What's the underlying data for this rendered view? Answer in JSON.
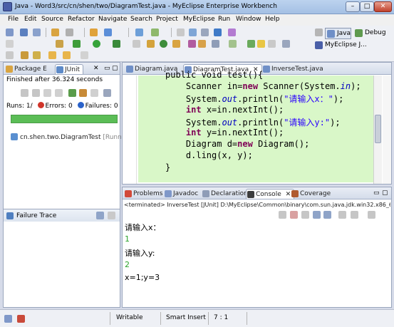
{
  "window": {
    "title": "Java - Word3/src/cn/shen/two/DiagramTest.java - MyEclipse Enterprise Workbench"
  },
  "menu": [
    "File",
    "Edit",
    "Source",
    "Refactor",
    "Navigate",
    "Search",
    "Project",
    "MyEclipse",
    "Run",
    "Window",
    "Help"
  ],
  "perspectives": {
    "java": "Java",
    "debug": "Debug",
    "myeclipse": "MyEclipse J..."
  },
  "left": {
    "tabs": {
      "package": "Package E",
      "junit": "JUnit"
    },
    "status": "Finished after 36.324 seconds",
    "runs_label": "Runs:",
    "runs_value": "1/",
    "errors_label": "Errors:",
    "errors_value": "0",
    "failures_label": "Failures:",
    "failures_value": "0",
    "test": {
      "name": "cn.shen.two.DiagramTest",
      "runner": "[Runne"
    },
    "failure_trace": "Failure Trace"
  },
  "editor": {
    "tabs": [
      "Diagram.java",
      "DiagramTest.java",
      "InverseTest.java"
    ],
    "lines": [
      {
        "parts": [
          {
            "t": "public void test(){",
            "c": "plain"
          }
        ]
      },
      {
        "parts": [
          {
            "t": "    Scanner in=",
            "c": "plain"
          },
          {
            "t": "new",
            "c": "kw"
          },
          {
            "t": " Scanner(System.",
            "c": "plain"
          },
          {
            "t": "in",
            "c": "it"
          },
          {
            "t": ");",
            "c": "plain"
          }
        ]
      },
      {
        "parts": [
          {
            "t": "    System.",
            "c": "plain"
          },
          {
            "t": "out",
            "c": "it"
          },
          {
            "t": ".println(",
            "c": "plain"
          },
          {
            "t": "\"请输入x：\"",
            "c": "str"
          },
          {
            "t": ");",
            "c": "plain"
          }
        ]
      },
      {
        "parts": [
          {
            "t": "    ",
            "c": "plain"
          },
          {
            "t": "int",
            "c": "kw"
          },
          {
            "t": " x=in.nextInt();",
            "c": "plain"
          }
        ]
      },
      {
        "parts": [
          {
            "t": "    System.",
            "c": "plain"
          },
          {
            "t": "out",
            "c": "it"
          },
          {
            "t": ".println(",
            "c": "plain"
          },
          {
            "t": "\"请输入y:\"",
            "c": "str"
          },
          {
            "t": ");",
            "c": "plain"
          }
        ]
      },
      {
        "parts": [
          {
            "t": "    ",
            "c": "plain"
          },
          {
            "t": "int",
            "c": "kw"
          },
          {
            "t": " y=in.nextInt();",
            "c": "plain"
          }
        ]
      },
      {
        "parts": [
          {
            "t": "    Diagram d=",
            "c": "plain"
          },
          {
            "t": "new",
            "c": "kw"
          },
          {
            "t": " Diagram();",
            "c": "plain"
          }
        ]
      },
      {
        "parts": [
          {
            "t": "    d.ling(x, y);",
            "c": "plain"
          }
        ]
      },
      {
        "parts": [
          {
            "t": "}",
            "c": "plain"
          }
        ]
      }
    ]
  },
  "console": {
    "tabs": [
      "Problems",
      "Javadoc",
      "Declaration",
      "Console",
      "Coverage"
    ],
    "terminated": "<terminated> InverseTest [JUnit] D:\\MyEclipse\\Common\\binary\\com.sun.java.jdk.win32.x86_6",
    "output": [
      {
        "text": "请输入x：",
        "kind": "out"
      },
      {
        "text": "1",
        "kind": "in"
      },
      {
        "text": "请输入y:",
        "kind": "out"
      },
      {
        "text": "2",
        "kind": "in"
      },
      {
        "text": "x=1;y=3",
        "kind": "out"
      }
    ]
  },
  "status": {
    "writable": "Writable",
    "insert": "Smart Insert",
    "position": "7 : 1"
  },
  "colors": {
    "progress": "#5bbd56",
    "highlight": "#d9f7c8",
    "keyword": "#7f0055",
    "string": "#2a00ff"
  }
}
